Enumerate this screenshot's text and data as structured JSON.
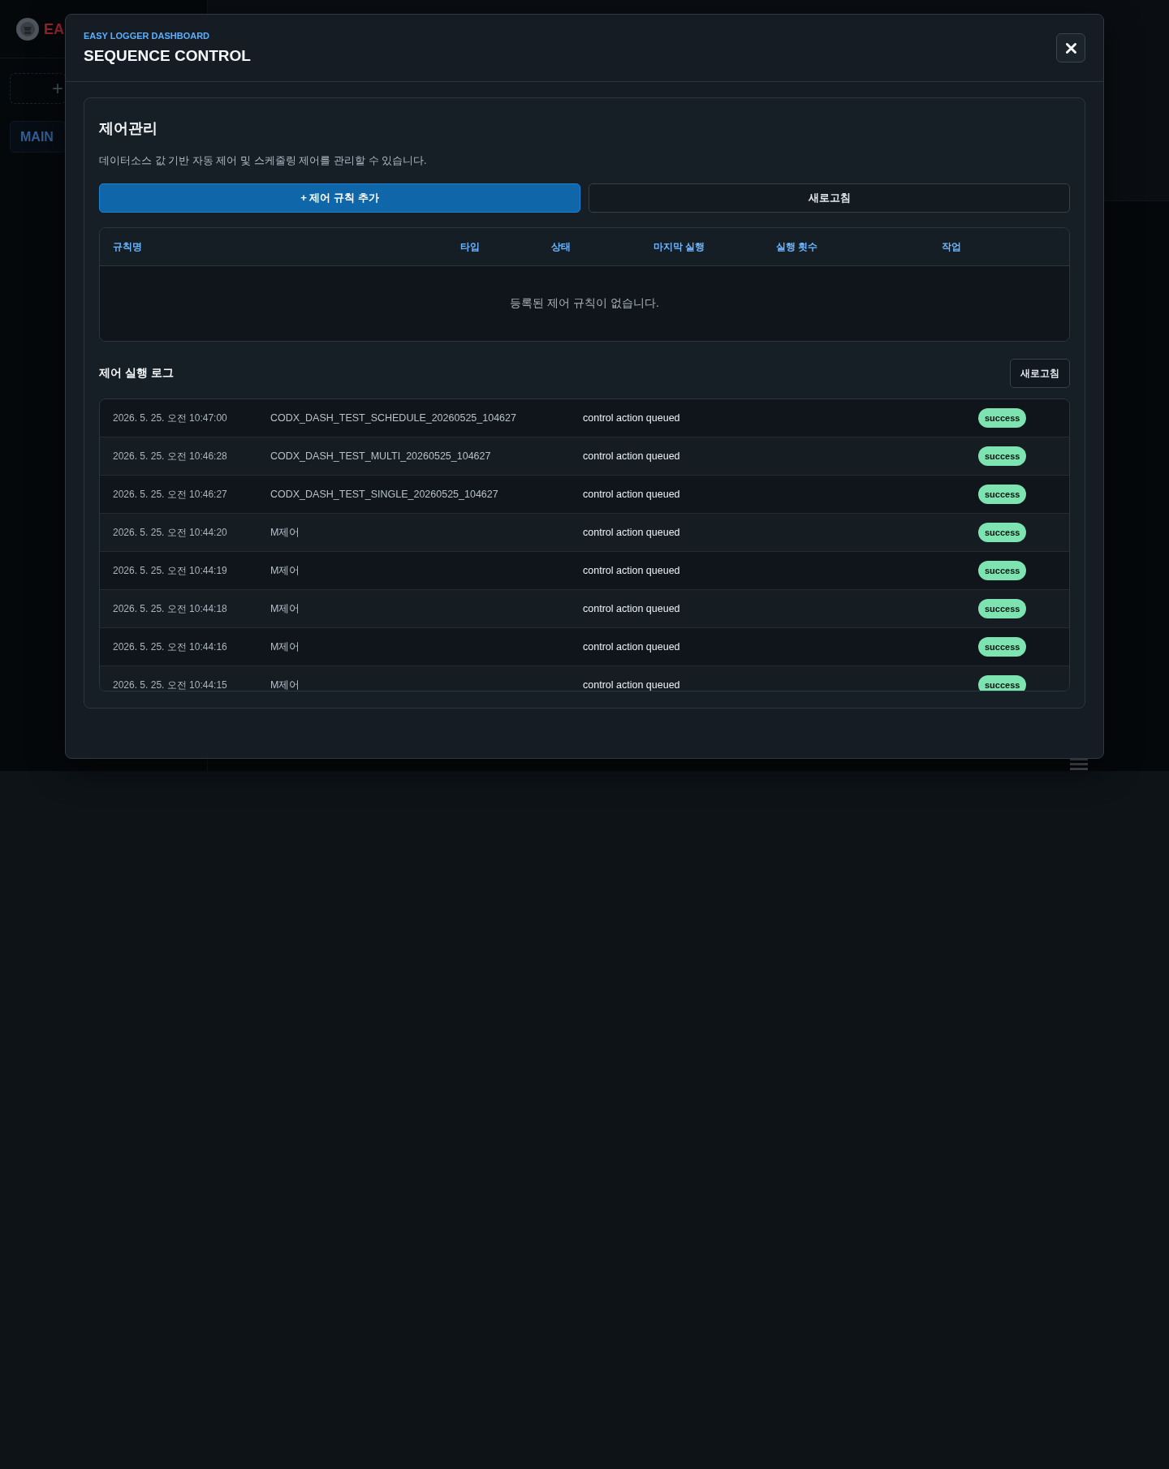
{
  "sidebar": {
    "brand": "EA",
    "add_button": "+",
    "items": [
      {
        "label": "MAIN"
      }
    ]
  },
  "modal": {
    "subtitle": "EASY LOGGER DASHBOARD",
    "title": "SEQUENCE CONTROL"
  },
  "rules": {
    "title": "제어관리",
    "description": "데이터소스 값 기반 자동 제어 및 스케줄링 제어를 관리할 수 있습니다.",
    "buttons": [
      {
        "label": "+ 제어 규칙 추가",
        "kind": "primary"
      },
      {
        "label": "새로고침",
        "kind": "secondary"
      }
    ],
    "columns": [
      "규칙명",
      "타입",
      "상태",
      "마지막 실행",
      "실행 횟수",
      "작업"
    ],
    "empty_message": "등록된 제어 규칙이 없습니다."
  },
  "log": {
    "title": "제어 실행 로그",
    "refresh_button": "새로고침",
    "rows": [
      {
        "time": "2026. 5. 25. 오전 10:47:00",
        "rule": "CODX_DASH_TEST_SCHEDULE_20260525_104627",
        "message": "control action queued",
        "status": "success"
      },
      {
        "time": "2026. 5. 25. 오전 10:46:28",
        "rule": "CODX_DASH_TEST_MULTI_20260525_104627",
        "message": "control action queued",
        "status": "success"
      },
      {
        "time": "2026. 5. 25. 오전 10:46:27",
        "rule": "CODX_DASH_TEST_SINGLE_20260525_104627",
        "message": "control action queued",
        "status": "success"
      },
      {
        "time": "2026. 5. 25. 오전 10:44:20",
        "rule": "M제어",
        "message": "control action queued",
        "status": "success"
      },
      {
        "time": "2026. 5. 25. 오전 10:44:19",
        "rule": "M제어",
        "message": "control action queued",
        "status": "success"
      },
      {
        "time": "2026. 5. 25. 오전 10:44:18",
        "rule": "M제어",
        "message": "control action queued",
        "status": "success"
      },
      {
        "time": "2026. 5. 25. 오전 10:44:16",
        "rule": "M제어",
        "message": "control action queued",
        "status": "success"
      },
      {
        "time": "2026. 5. 25. 오전 10:44:15",
        "rule": "M제어",
        "message": "control action queued",
        "status": "success"
      }
    ]
  }
}
